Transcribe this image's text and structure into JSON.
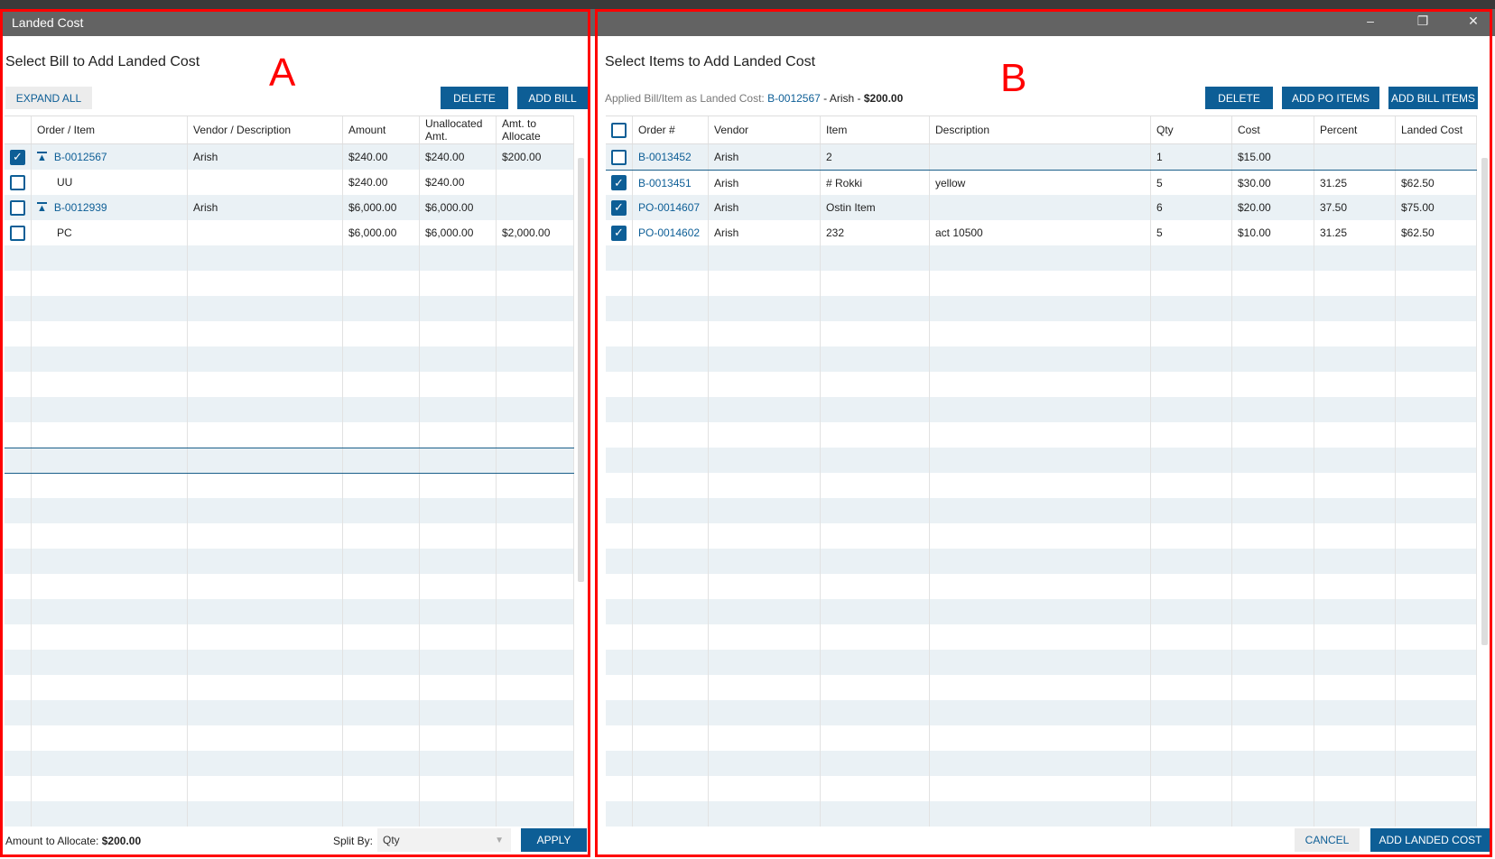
{
  "window": {
    "title": "Landed Cost",
    "controls": [
      "minimize",
      "restore",
      "close"
    ]
  },
  "annotations": {
    "a": "A",
    "b": "B",
    "color": "#ff0000"
  },
  "accent": "#0d5e96",
  "left": {
    "heading": "Select Bill to Add Landed Cost",
    "expand_all": "EXPAND ALL",
    "delete": "DELETE",
    "add_bill": "ADD BILL",
    "columns": [
      "",
      "Order / Item",
      "Vendor / Description",
      "Amount",
      "Unallocated Amt.",
      "Amt. to Allocate"
    ],
    "rows": [
      {
        "checked": true,
        "expand": true,
        "order": "B-0012567",
        "vendor": "Arish",
        "amount": "$240.00",
        "unallocated": "$240.00",
        "allocate": "$200.00"
      },
      {
        "checked": false,
        "expand": false,
        "order": "UU",
        "vendor": "",
        "amount": "$240.00",
        "unallocated": "$240.00",
        "allocate": ""
      },
      {
        "checked": false,
        "expand": true,
        "order": "B-0012939",
        "vendor": "Arish",
        "amount": "$6,000.00",
        "unallocated": "$6,000.00",
        "allocate": ""
      },
      {
        "checked": false,
        "expand": false,
        "order": "PC",
        "vendor": "",
        "amount": "$6,000.00",
        "unallocated": "$6,000.00",
        "allocate": "$2,000.00"
      }
    ],
    "amount_label": "Amount to Allocate:",
    "amount_value": "$200.00",
    "split_label": "Split By:",
    "split_value": "Qty",
    "apply": "APPLY"
  },
  "right": {
    "heading": "Select Items to Add Landed Cost",
    "applied_label": "Applied Bill/Item as Landed Cost:",
    "applied_bill": "B-0012567",
    "applied_vendor": "Arish",
    "applied_amount": "$200.00",
    "sep": "-",
    "delete": "DELETE",
    "add_po_items": "ADD PO ITEMS",
    "add_bill_items": "ADD BILL ITEMS",
    "columns": [
      "",
      "Order #",
      "Vendor",
      "Item",
      "Description",
      "Qty",
      "Cost",
      "Percent",
      "Landed Cost"
    ],
    "rows": [
      {
        "checked": false,
        "order": "B-0013452",
        "vendor": "Arish",
        "item": "2",
        "description": "",
        "qty": "1",
        "cost": "$15.00",
        "percent": "",
        "landed": ""
      },
      {
        "checked": true,
        "order": "B-0013451",
        "vendor": "Arish",
        "item": "# Rokki",
        "description": "yellow",
        "qty": "5",
        "cost": "$30.00",
        "percent": "31.25",
        "landed": "$62.50"
      },
      {
        "checked": true,
        "order": "PO-0014607",
        "vendor": "Arish",
        "item": "Ostin Item",
        "description": "",
        "qty": "6",
        "cost": "$20.00",
        "percent": "37.50",
        "landed": "$75.00"
      },
      {
        "checked": true,
        "order": "PO-0014602",
        "vendor": "Arish",
        "item": "232",
        "description": "act 10500",
        "qty": "5",
        "cost": "$10.00",
        "percent": "31.25",
        "landed": "$62.50"
      }
    ],
    "cancel": "CANCEL",
    "add_landed_cost": "ADD LANDED COST"
  }
}
